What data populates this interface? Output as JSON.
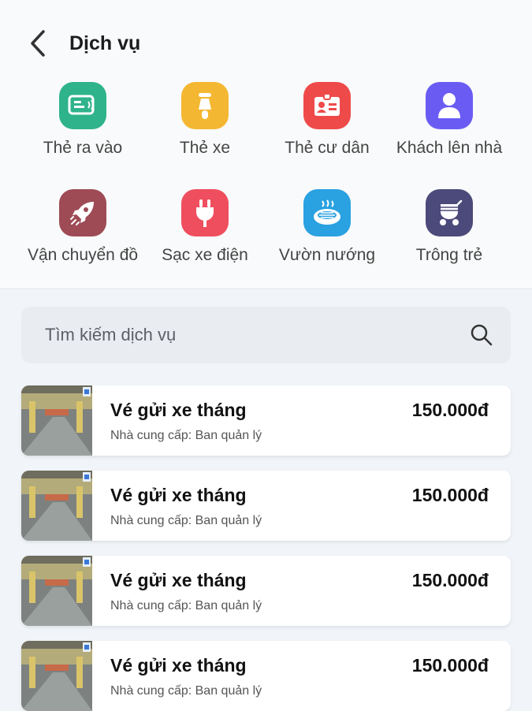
{
  "header": {
    "title": "Dịch vụ"
  },
  "services": [
    {
      "label": "Thẻ ra vào",
      "icon": "access-card-icon",
      "color": "#2fb38a"
    },
    {
      "label": "Thẻ xe",
      "icon": "scooter-icon",
      "color": "#f4b731"
    },
    {
      "label": "Thẻ cư dân",
      "icon": "id-card-icon",
      "color": "#ef4a4a"
    },
    {
      "label": "Khách lên nhà",
      "icon": "person-icon",
      "color": "#6a5cf3"
    },
    {
      "label": "Vận chuyển đồ",
      "icon": "rocket-icon",
      "color": "#9e4b56"
    },
    {
      "label": "Sạc xe điện",
      "icon": "plug-icon",
      "color": "#ef4e5e"
    },
    {
      "label": "Vườn nướng",
      "icon": "grill-icon",
      "color": "#2aa1e0"
    },
    {
      "label": "Trông trẻ",
      "icon": "stroller-icon",
      "color": "#4c4a7a"
    }
  ],
  "search": {
    "placeholder": "Tìm kiếm dịch vụ"
  },
  "items": [
    {
      "title": "Vé gửi xe tháng",
      "provider": "Nhà cung cấp: Ban quản lý",
      "price": "150.000đ"
    },
    {
      "title": "Vé gửi xe tháng",
      "provider": "Nhà cung cấp: Ban quản lý",
      "price": "150.000đ"
    },
    {
      "title": "Vé gửi xe tháng",
      "provider": "Nhà cung cấp: Ban quản lý",
      "price": "150.000đ"
    },
    {
      "title": "Vé gửi xe tháng",
      "provider": "Nhà cung cấp: Ban quản lý",
      "price": "150.000đ"
    }
  ]
}
